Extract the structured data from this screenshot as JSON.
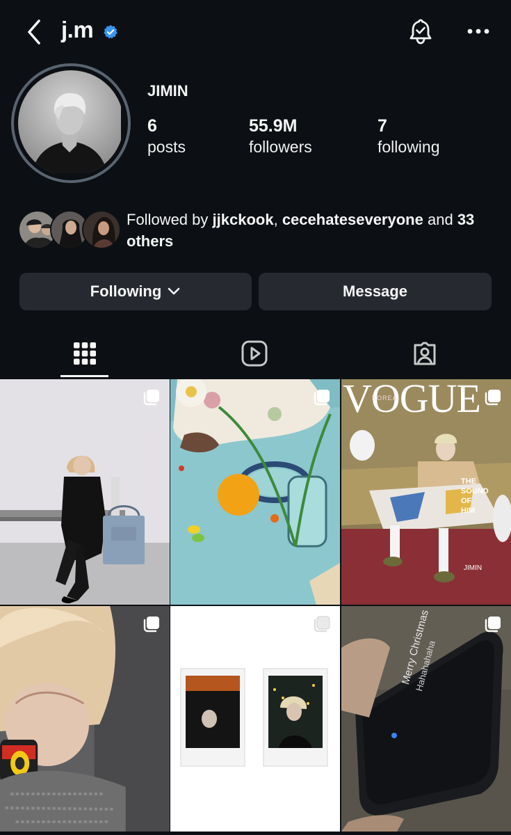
{
  "header": {
    "username": "j.m",
    "back_icon": "chevron-left-icon",
    "verified_icon": "verified-badge-icon",
    "notifications_icon": "bell-icon",
    "more_icon": "more-horizontal-icon"
  },
  "profile": {
    "full_name": "JIMIN",
    "stats": [
      {
        "value": "6",
        "label": "posts"
      },
      {
        "value": "55.9M",
        "label": "followers"
      },
      {
        "value": "7",
        "label": "following"
      }
    ],
    "followed_by": {
      "prefix": "Followed by",
      "user1": "jjkckook",
      "separator": ",",
      "user2": "cecehateseveryone",
      "conjunction": "and",
      "others": "33 others"
    }
  },
  "actions": {
    "following_label": "Following",
    "message_label": "Message"
  },
  "tabs": [
    {
      "icon": "grid-icon",
      "selected": true
    },
    {
      "icon": "reels-icon",
      "selected": false
    },
    {
      "icon": "tagged-icon",
      "selected": false
    }
  ],
  "colors": {
    "background": "#0c1014",
    "button": "#262a30",
    "verified": "#3897f0",
    "text": "#f5f5f5"
  },
  "grid_posts": [
    {
      "name": "post-suit-bench",
      "multi": true
    },
    {
      "name": "post-table-still-life",
      "multi": true
    },
    {
      "name": "post-vogue-cover",
      "multi": true,
      "overlay": {
        "brand": "VOGUE",
        "edition": "KOREA",
        "side_text": "THE SOUND OF HIM",
        "name": "JIMIN"
      }
    },
    {
      "name": "post-selfie-camera",
      "multi": true
    },
    {
      "name": "post-polaroids",
      "multi": true
    },
    {
      "name": "post-phone-message",
      "multi": true,
      "overlay": {
        "text1": "Merry Christmas",
        "text2": "Hahahahaha"
      }
    }
  ]
}
